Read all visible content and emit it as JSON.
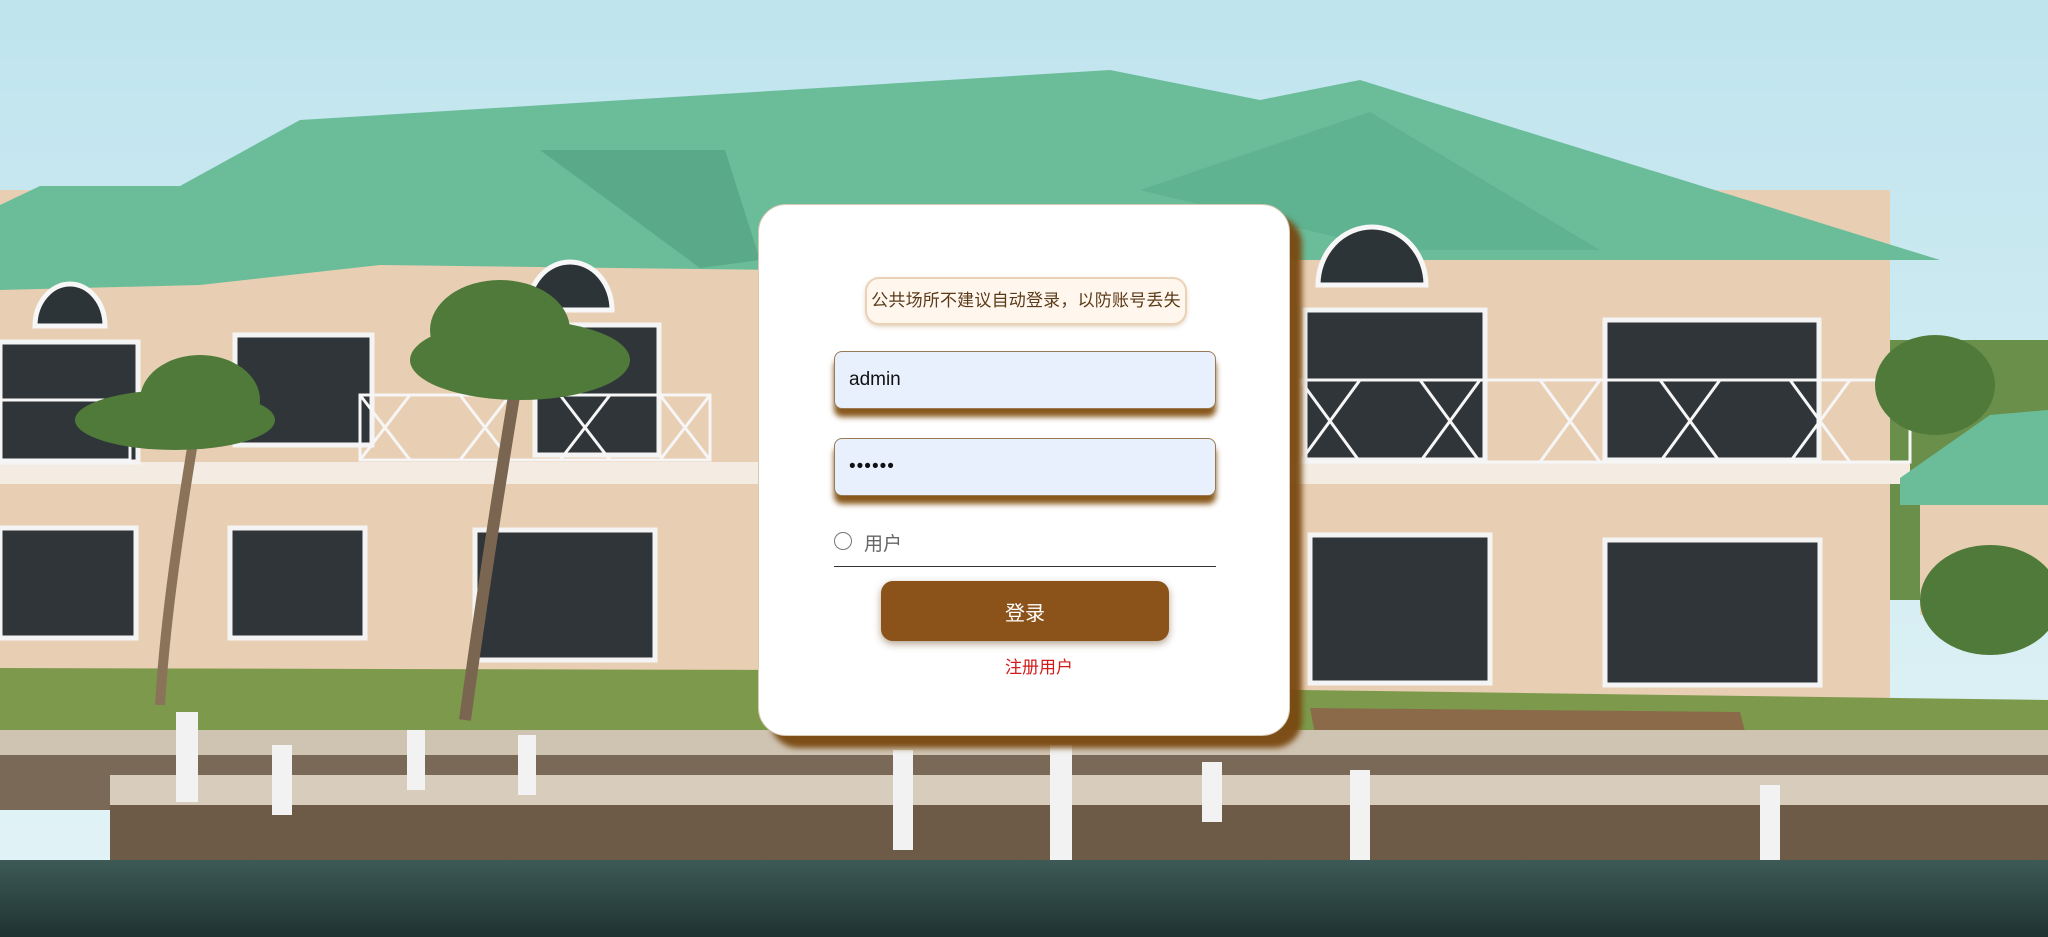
{
  "background": {
    "description_icon": "house-photo"
  },
  "login": {
    "notice": "公共场所不建议自动登录，以防账号丢失",
    "username_value": "admin",
    "password_value": "••••••",
    "role_option_label": "用户",
    "role_selected": false,
    "login_button_label": "登录",
    "register_link_label": "注册用户"
  },
  "colors": {
    "accent": "#8b5219",
    "register_link": "#d21b1b",
    "input_fill": "#e8f0fe"
  }
}
